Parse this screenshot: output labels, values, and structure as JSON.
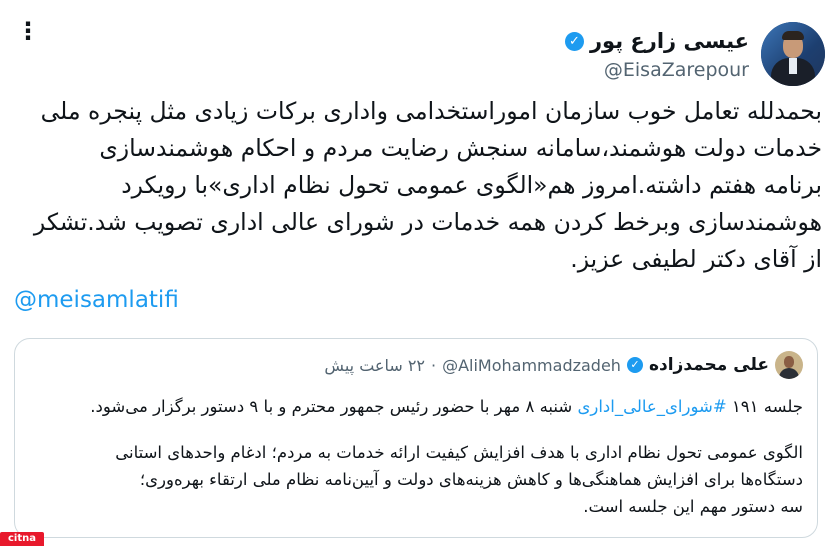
{
  "tweet": {
    "author_name": "عیسی زارع پور",
    "handle": "@EisaZarepour",
    "text_line1": "بحمدلله تعامل خوب سازمان اموراستخدامی واداری برکات زیادی مثل پنجره ملی",
    "text_line2": "خدمات دولت هوشمند،سامانه سنجش رضایت مردم و احکام هوشمندسازی",
    "text_line3": "برنامه هفتم داشته.امروز هم«الگوی عمومی تحول نظام اداری»با رویکرد",
    "text_line4": "هوشمندسازی وبرخط کردن همه خدمات در شورای عالی اداری تصویب شد.تشکر",
    "text_line5": "از آقای دکتر لطیفی عزیز.",
    "mention": "@meisamlatifi"
  },
  "quoted": {
    "author_name": "علی محمدزاده",
    "handle": "@AliMohammadzadeh",
    "separator": "·",
    "time": "۲۲ ساعت پیش",
    "line1_prefix": "جلسه ۱۹۱ ",
    "hashtag": "#شورای_عالی_اداری",
    "line1_suffix": " شنبه ۸ مهر با حضور رئیس جمهور محترم و با ۹ دستور برگزار می‌شود.",
    "para2_line1": "الگوی عمومی تحول نظام اداری با هدف افزایش کیفیت ارائه خدمات به مردم؛ ادغام واحدهای استانی",
    "para2_line2": "دستگاه‌ها برای افزایش هماهنگی‌ها و کاهش هزینه‌های دولت و آیین‌نامه نظام ملی ارتقاء بهره‌وری؛",
    "para2_line3": "سه دستور مهم این جلسه است."
  },
  "watermark": {
    "text": "citna"
  },
  "colors": {
    "link": "#1d9bf0",
    "secondary_text": "#536471",
    "verified_badge": "#1d9bf0",
    "watermark_bg": "#e8192c"
  },
  "icons": {
    "more": "more-vertical-icon",
    "verified": "verified-badge-icon"
  }
}
